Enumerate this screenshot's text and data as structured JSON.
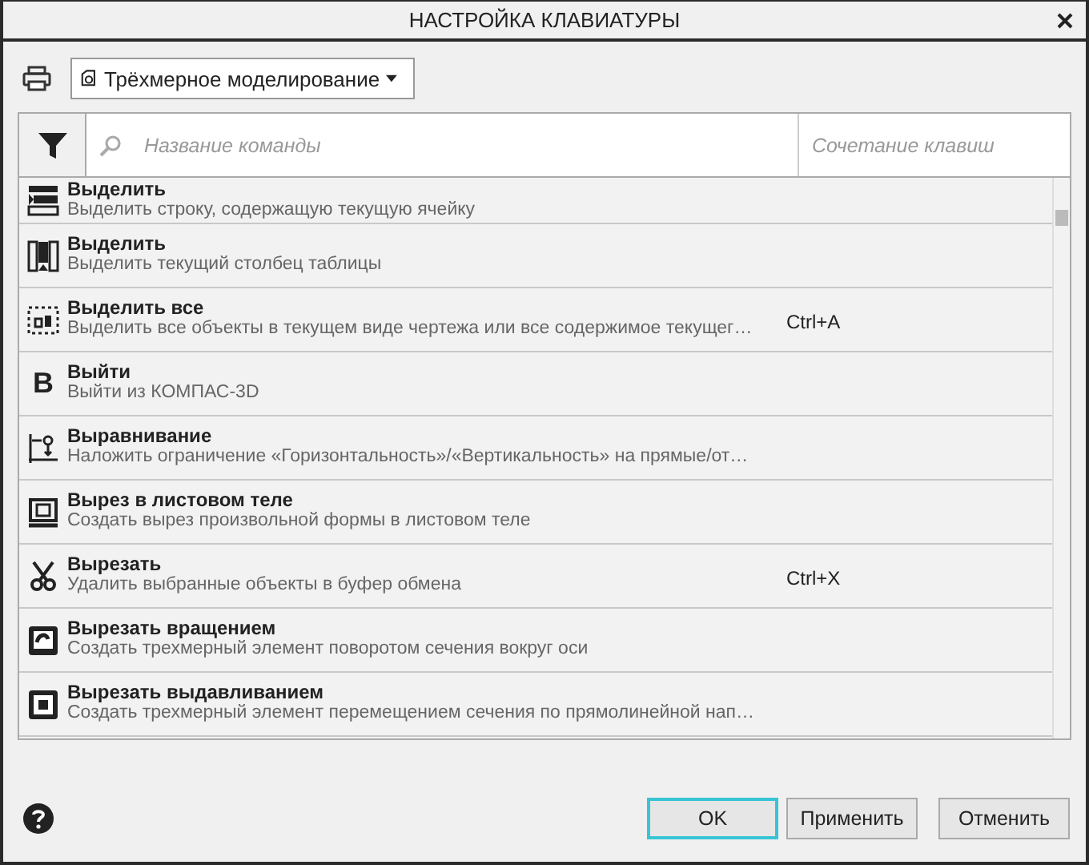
{
  "window": {
    "title": "НАСТРОЙКА КЛАВИАТУРЫ"
  },
  "toolbar": {
    "mode_select": {
      "value": "Трёхмерное моделирование"
    }
  },
  "table": {
    "search": {
      "placeholder": "Название команды"
    },
    "shortcut_column": {
      "placeholder": "Сочетание клавиш"
    },
    "rows": [
      {
        "name": "Выделить",
        "description": "Выделить строку, содержащую текущую ячейку"
      },
      {
        "name": "Выделить",
        "description": "Выделить текущий столбец таблицы"
      },
      {
        "name": "Выделить все",
        "description": "Выделить все объекты в текущем виде чертежа или все содержимое текущег…",
        "shortcut": "Ctrl+A"
      },
      {
        "name": "Выйти",
        "description": "Выйти из КОМПАС-3D",
        "icon_letter": "B"
      },
      {
        "name": "Выравнивание",
        "description": "Наложить ограничение «Горизонтальность»/«Вертикальность» на прямые/от…"
      },
      {
        "name": "Вырез в листовом теле",
        "description": "Создать вырез произвольной формы в листовом теле"
      },
      {
        "name": "Вырезать",
        "description": "Удалить выбранные объекты в буфер обмена",
        "shortcut": "Ctrl+X"
      },
      {
        "name": "Вырезать вращением",
        "description": "Создать трехмерный элемент поворотом сечения вокруг оси"
      },
      {
        "name": "Вырезать выдавливанием",
        "description": "Создать трехмерный элемент перемещением сечения по прямолинейной нап…"
      }
    ]
  },
  "buttons": [
    {
      "label": "OK",
      "focused": true
    },
    {
      "label": "Применить",
      "focused": false
    },
    {
      "label": "Отменить",
      "focused": false
    }
  ]
}
